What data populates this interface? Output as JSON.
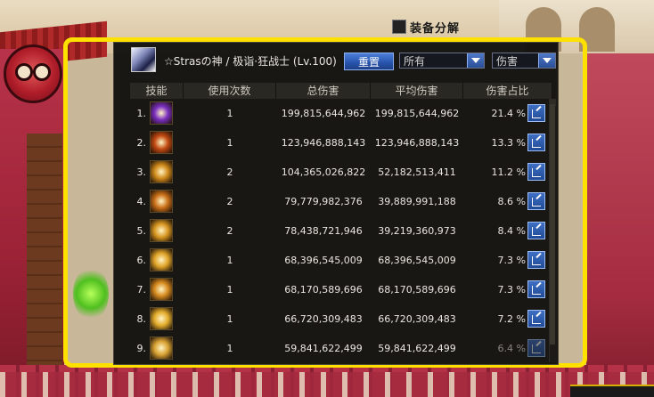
{
  "scene": {
    "equip_button_label": "装备分解"
  },
  "panel": {
    "title": "☆Strasの神 / 极诣·狂战士 (Lv.100)",
    "reset_label": "重置",
    "filter_select": "所有",
    "metric_select": "伤害",
    "columns": [
      "技能",
      "使用次数",
      "总伤害",
      "平均伤害",
      "伤害占比"
    ],
    "rows": [
      {
        "rank": "1.",
        "uses": "1",
        "total": "199,815,644,962",
        "avg": "199,815,644,962",
        "pct": "21.4 %",
        "icon_color": "#7a2fbf"
      },
      {
        "rank": "2.",
        "uses": "1",
        "total": "123,946,888,143",
        "avg": "123,946,888,143",
        "pct": "13.3 %",
        "icon_color": "#c24a12"
      },
      {
        "rank": "3.",
        "uses": "2",
        "total": "104,365,026,822",
        "avg": "52,182,513,411",
        "pct": "11.2 %",
        "icon_color": "#d08a1a"
      },
      {
        "rank": "4.",
        "uses": "2",
        "total": "79,779,982,376",
        "avg": "39,889,991,188",
        "pct": "8.6 %",
        "icon_color": "#c96f18"
      },
      {
        "rank": "5.",
        "uses": "2",
        "total": "78,438,721,946",
        "avg": "39,219,360,973",
        "pct": "8.4 %",
        "icon_color": "#d79620"
      },
      {
        "rank": "6.",
        "uses": "1",
        "total": "68,396,545,009",
        "avg": "68,396,545,009",
        "pct": "7.3 %",
        "icon_color": "#e0a428"
      },
      {
        "rank": "7.",
        "uses": "1",
        "total": "68,170,589,696",
        "avg": "68,170,589,696",
        "pct": "7.3 %",
        "icon_color": "#d68a1e"
      },
      {
        "rank": "8.",
        "uses": "1",
        "total": "66,720,309,483",
        "avg": "66,720,309,483",
        "pct": "7.2 %",
        "icon_color": "#e3ac2c"
      },
      {
        "rank": "9.",
        "uses": "1",
        "total": "59,841,622,499",
        "avg": "59,841,622,499",
        "pct": "6.4 %",
        "icon_color": "#d9a233"
      }
    ]
  }
}
